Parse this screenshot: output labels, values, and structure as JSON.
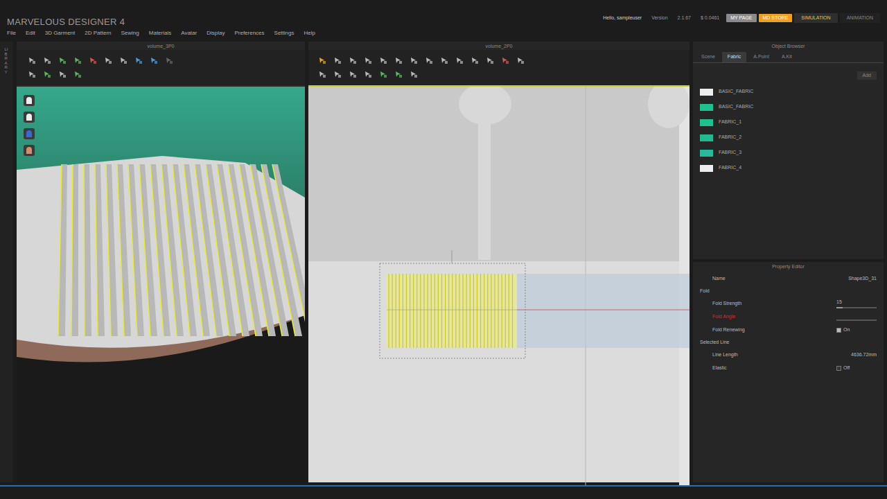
{
  "app": {
    "title": "MARVELOUS DESIGNER 4"
  },
  "menu": [
    "File",
    "Edit",
    "3D Garment",
    "2D Pattern",
    "Sewing",
    "Materials",
    "Avatar",
    "Display",
    "Preferences",
    "Settings",
    "Help"
  ],
  "header": {
    "greeting": "Hello, sampleuser",
    "version_label": "Version",
    "version": "2.1.67",
    "counter": "$ 0.0461"
  },
  "header_buttons": [
    {
      "label": "MY PAGE",
      "color": "#8a8a8a"
    },
    {
      "label": "MD STORE",
      "color": "#f0a020"
    }
  ],
  "modes": [
    {
      "label": "SIMULATION",
      "selected": true
    },
    {
      "label": "ANIMATION",
      "selected": false
    }
  ],
  "library": {
    "label": "LIBRARY"
  },
  "view3d": {
    "title": "volume_3P0"
  },
  "view2d": {
    "title": "volume_2P0"
  },
  "object_browser": {
    "title": "Object Browser",
    "tabs": [
      {
        "label": "Scene",
        "selected": false
      },
      {
        "label": "Fabric",
        "selected": true
      },
      {
        "label": "A.Point",
        "selected": false
      },
      {
        "label": "A.Kit",
        "selected": false
      }
    ],
    "add": "Add",
    "fabrics": [
      {
        "name": "BASIC_FABRIC",
        "color": "#eeeeee"
      },
      {
        "name": "BASIC_FABRIC",
        "color": "#1fbf8f"
      },
      {
        "name": "FABRIC_1",
        "color": "#1fbf8f"
      },
      {
        "name": "FABRIC_2",
        "color": "#22b98e"
      },
      {
        "name": "FABRIC_3",
        "color": "#2cb89a"
      },
      {
        "name": "FABRIC_4",
        "color": "#eeeeee"
      }
    ]
  },
  "property_editor": {
    "title": "Property Editor",
    "rows": [
      {
        "kind": "value",
        "label": "Name",
        "value": "Shape3D_31",
        "color": "#bbbbbb"
      },
      {
        "kind": "section",
        "label": "Fold",
        "color": "#bbbbbb"
      },
      {
        "kind": "slider",
        "label": "Fold Strength",
        "value": "15",
        "level": 0.15,
        "color": "#bbbbbb"
      },
      {
        "kind": "slider",
        "label": "Fold Angle",
        "value": "",
        "level": 0,
        "color": "#d03030"
      },
      {
        "kind": "checkbox",
        "label": "Fold Renewing",
        "value": "On",
        "checked": true,
        "color": "#bbbbbb"
      },
      {
        "kind": "section",
        "label": "Selected Line",
        "color": "#bbbbbb"
      },
      {
        "kind": "value",
        "label": "Line Length",
        "value": "4636.72mm",
        "color": "#bbbbbb"
      },
      {
        "kind": "checkbox",
        "label": "Elastic",
        "value": "Off",
        "checked": false,
        "color": "#bbbbbb"
      }
    ]
  }
}
